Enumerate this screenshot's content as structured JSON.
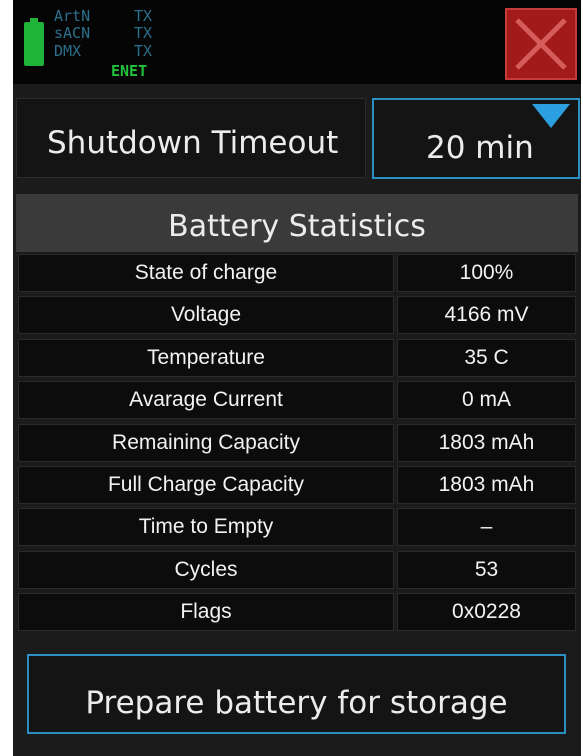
{
  "status_bar": {
    "protocols": [
      "ArtN",
      "sACN",
      "DMX"
    ],
    "tx_labels": [
      "TX",
      "TX",
      "TX"
    ],
    "network": "ENET",
    "battery_icon": "battery-icon",
    "close_icon": "close-icon"
  },
  "shutdown": {
    "label": "Shutdown Timeout",
    "value": "20 min",
    "dropdown_icon": "dropdown-arrow-icon"
  },
  "battery_stats": {
    "title": "Battery Statistics",
    "rows": [
      {
        "label": "State of charge",
        "value": "100%"
      },
      {
        "label": "Voltage",
        "value": "4166 mV"
      },
      {
        "label": "Temperature",
        "value": "35 C"
      },
      {
        "label": "Avarage Current",
        "value": "0 mA"
      },
      {
        "label": "Remaining Capacity",
        "value": "1803 mAh"
      },
      {
        "label": "Full Charge Capacity",
        "value": "1803 mAh"
      },
      {
        "label": "Time to Empty",
        "value": "–"
      },
      {
        "label": "Cycles",
        "value": "53"
      },
      {
        "label": "Flags",
        "value": "0x0228"
      }
    ]
  },
  "storage_button": {
    "label": "Prepare battery for storage"
  },
  "colors": {
    "accent": "#2b8fc4",
    "battery_green": "#1fb33a",
    "close_red": "#a21a1a",
    "background": "#1b1b1b"
  }
}
